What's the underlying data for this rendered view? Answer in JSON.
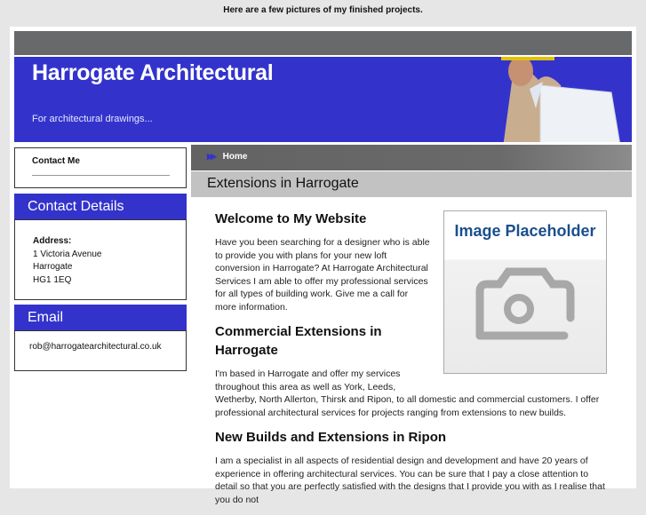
{
  "top_note": "Here are a few pictures of my finished projects.",
  "header": {
    "title": "Harrogate Architectural",
    "tagline": "For architectural drawings..."
  },
  "sidebar": {
    "contact_me": "Contact Me",
    "contact_details": {
      "heading": "Contact Details",
      "address_label": "Address:",
      "lines": [
        "1 Victoria Avenue",
        "Harrogate",
        "HG1 1EQ"
      ]
    },
    "email": {
      "heading": "Email",
      "address": "rob@harrogatearchitectural.co.uk"
    }
  },
  "nav": {
    "home": "Home"
  },
  "main": {
    "page_title": "Extensions in Harrogate",
    "image_placeholder": "Image Placeholder",
    "sections": [
      {
        "heading": "Welcome to My Website",
        "text": "Have you been searching for a designer who is able to provide you with plans for your new loft conversion in Harrogate? At Harrogate Architectural Services I am able to offer my professional services for all types of building work. Give me a call for more information."
      },
      {
        "heading": "Commercial Extensions in Harrogate",
        "text": "I'm based in Harrogate and offer my services throughout this area as well as York, Leeds, Wetherby, North Allerton, Thirsk and Ripon, to all domestic and commercial customers. I offer professional architectural services for projects ranging from extensions to new builds."
      },
      {
        "heading": "New Builds and Extensions in Ripon",
        "text": "I am a specialist in all aspects of residential design and development and have 20 years of experience in offering architectural services. You can be sure that I pay a close attention to detail so that you are perfectly satisfied with the designs that I provide you with as I realise that you do not"
      }
    ]
  },
  "colors": {
    "brand_blue": "#3333cc",
    "header_gray": "#68696b"
  }
}
